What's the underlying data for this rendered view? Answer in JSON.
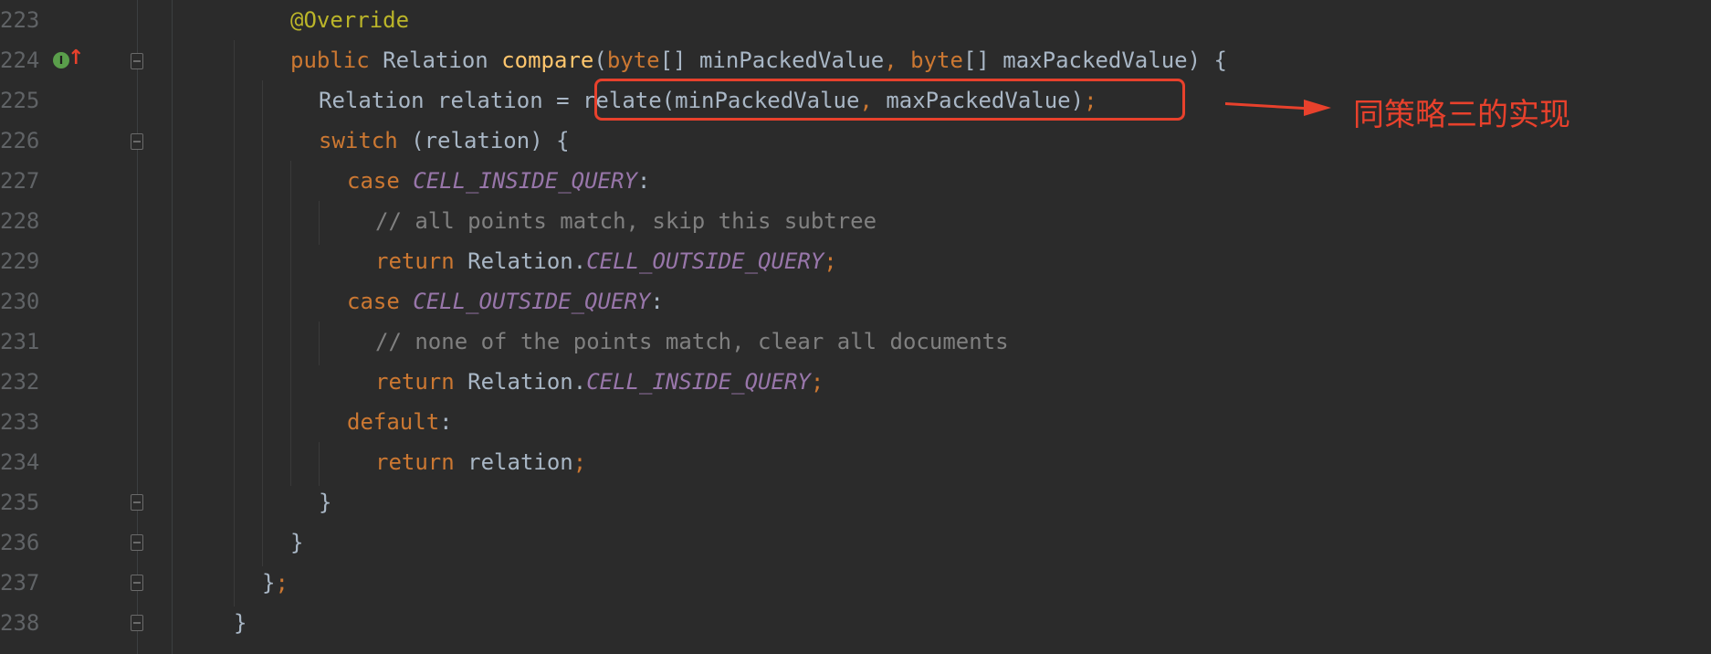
{
  "editor": {
    "lines": [
      {
        "no": "223"
      },
      {
        "no": "224"
      },
      {
        "no": "225"
      },
      {
        "no": "226"
      },
      {
        "no": "227"
      },
      {
        "no": "228"
      },
      {
        "no": "229"
      },
      {
        "no": "230"
      },
      {
        "no": "231"
      },
      {
        "no": "232"
      },
      {
        "no": "233"
      },
      {
        "no": "234"
      },
      {
        "no": "235"
      },
      {
        "no": "236"
      },
      {
        "no": "237"
      },
      {
        "no": "238"
      }
    ],
    "tokens": {
      "l223_ann": "@Override",
      "l224_public": "public",
      "l224_type": " Relation ",
      "l224_fn": "compare",
      "l224_p1": "(",
      "l224_byte1": "byte",
      "l224_p2": "[] minPackedValue",
      "l224_comma": ",",
      "l224_sp": " ",
      "l224_byte2": "byte",
      "l224_p3": "[] maxPackedValue) {",
      "l225_a": "Relation relation = relate(minPackedValue",
      "l225_comma": ",",
      "l225_b": " maxPackedValue)",
      "l225_semi": ";",
      "l226_kw": "switch",
      "l226_rest": " (relation) {",
      "l227_kw": "case",
      "l227_sp": " ",
      "l227_const": "CELL_INSIDE_QUERY",
      "l227_colon": ":",
      "l228_cmt": "// all points match, skip this subtree",
      "l229_kw": "return",
      "l229_txt": " Relation.",
      "l229_const": "CELL_OUTSIDE_QUERY",
      "l229_semi": ";",
      "l230_kw": "case",
      "l230_sp": " ",
      "l230_const": "CELL_OUTSIDE_QUERY",
      "l230_colon": ":",
      "l231_cmt": "// none of the points match, clear all documents",
      "l232_kw": "return",
      "l232_txt": " Relation.",
      "l232_const": "CELL_INSIDE_QUERY",
      "l232_semi": ";",
      "l233_kw": "default",
      "l233_colon": ":",
      "l234_kw": "return",
      "l234_txt": " relation",
      "l234_semi": ";",
      "l235_brace": "}",
      "l236_brace": "}",
      "l237_brace": "}",
      "l237_semi": ";",
      "l238_brace": "}"
    },
    "gutter_icon_label": "I"
  },
  "annotation": {
    "text": "同策略三的实现",
    "color": "#e8412c"
  },
  "theme": {
    "background": "#2b2b2b",
    "keyword": "#cc7832",
    "annotation_color": "#bbb529",
    "function": "#ffc66d",
    "constant": "#9876aa",
    "comment": "#808080",
    "text": "#a9b7c6",
    "line_number": "#606366"
  }
}
